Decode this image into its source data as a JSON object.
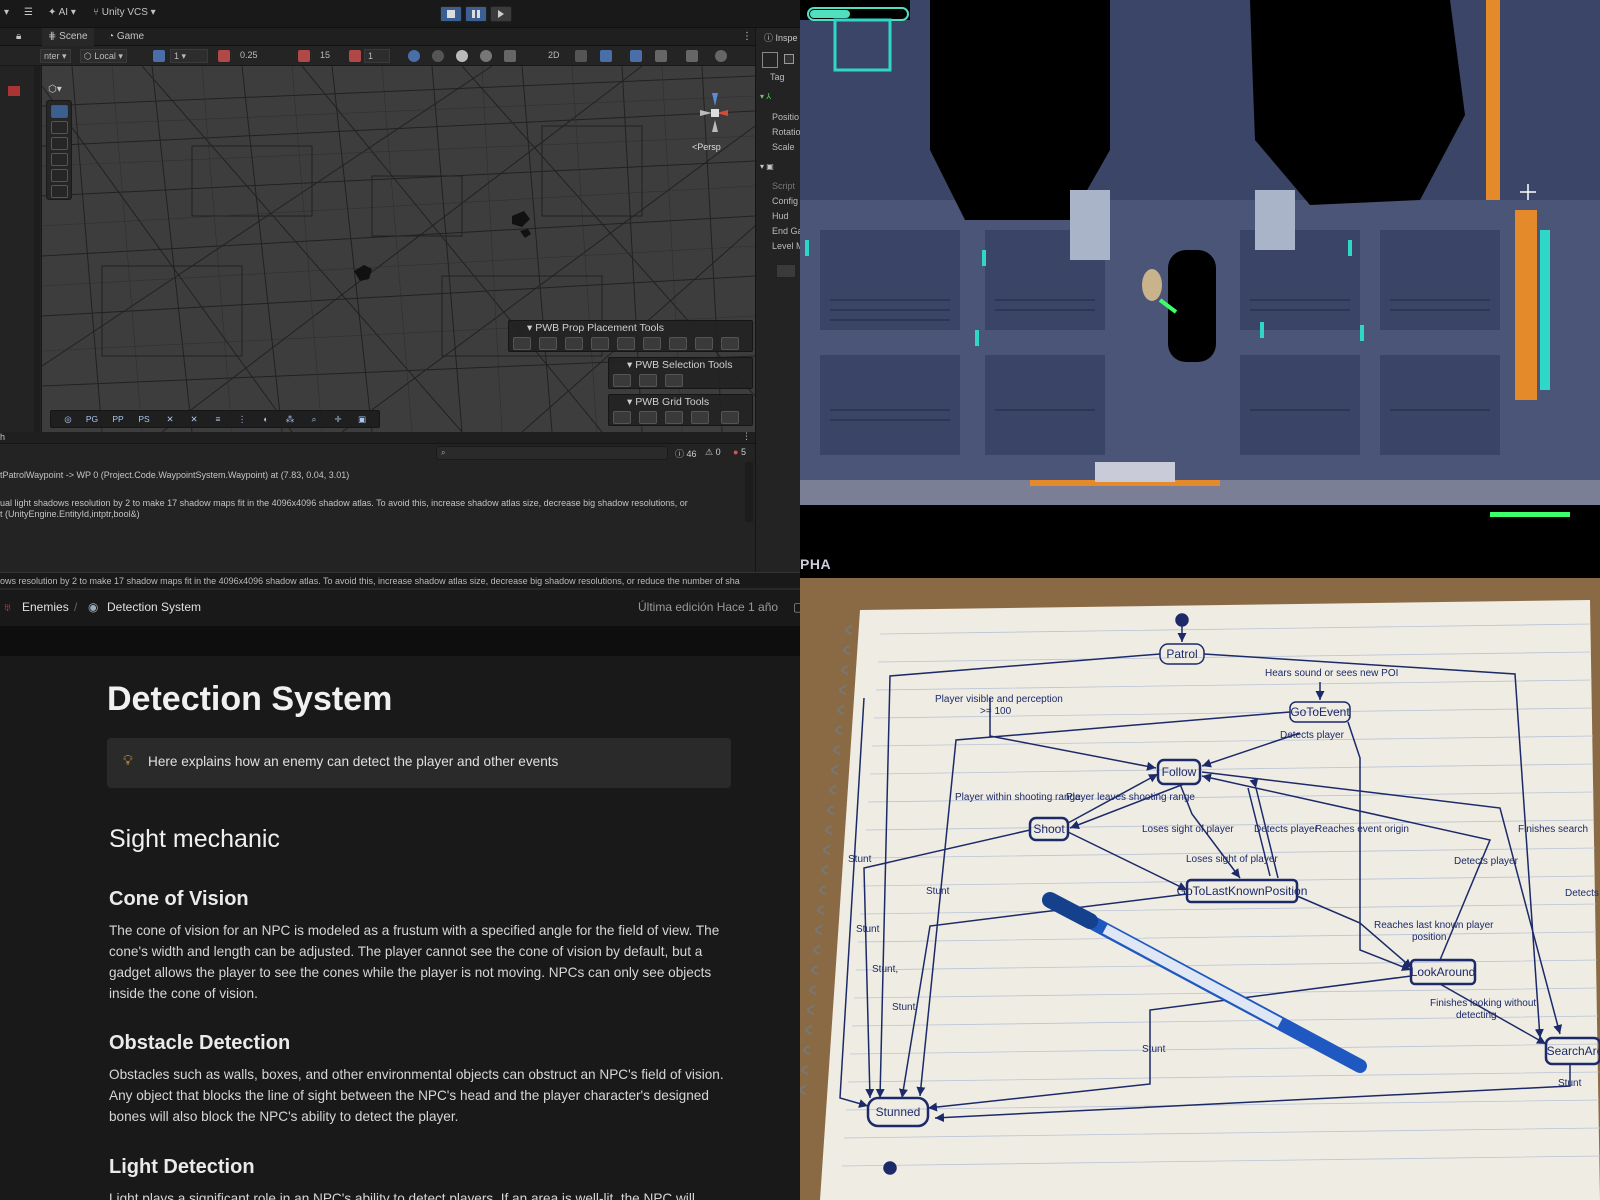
{
  "unity": {
    "toolbar": {
      "ai_label": "AI",
      "vcs_label": "Unity VCS"
    },
    "tabs": {
      "scene": "Scene",
      "game": "Game",
      "inspector": "Inspe"
    },
    "scene_toolbar": {
      "pivot": "nter",
      "space": "Local",
      "grid_value": "1",
      "snap_value": "0.25",
      "angle_value": "15",
      "scale_value": "1",
      "mode_2d": "2D"
    },
    "persp_label": "<Persp",
    "overlays": {
      "prop_placement": "PWB Prop Placement Tools",
      "selection": "PWB Selection Tools",
      "grid": "PWB Grid Tools"
    },
    "bottom_toolbar": [
      "PG",
      "PP",
      "PS"
    ],
    "console": {
      "tab_fragment": "h",
      "counts": {
        "logs": "46",
        "warnings": "0",
        "errors": "5"
      },
      "line1": "tPatrolWaypoint -> WP 0 (Project.Code.WaypointSystem.Waypoint) at (7.83, 0.04, 3.01)",
      "line2": "ual light shadows resolution by 2 to make 17 shadow maps fit in the 4096x4096 shadow atlas. To avoid this, increase shadow atlas size, decrease big shadow resolutions, or",
      "line3": "t (UnityEngine.EntityId,intptr,bool&)"
    },
    "status_message": "ows resolution by 2 to make 17 shadow maps fit in the 4096x4096 shadow atlas. To avoid this, increase shadow atlas size, decrease big shadow resolutions, or reduce the number of sha",
    "inspector": {
      "tag": "Tag",
      "transform": [
        "Positio",
        "Rotatio",
        "Scale"
      ],
      "component": [
        "Script",
        "Config",
        "Hud",
        "End Ga",
        "Level M"
      ]
    }
  },
  "game": {
    "overlay_text": "PHA"
  },
  "notion": {
    "breadcrumb": {
      "parent": "Enemies",
      "current": "Detection System",
      "last_edited": "Última edición Hace 1 año"
    },
    "title": "Detection System",
    "callout": "Here explains how an enemy can detect the player and other events",
    "h2_sight": "Sight mechanic",
    "cone_heading": "Cone of Vision",
    "cone_text": "The cone of vision for an NPC is modeled as a frustum with a specified angle for the field of view. The cone's width and length can be adjusted. The player cannot see the cone of vision by default, but a gadget allows the player to see the cones while the player is not moving. NPCs can only see objects inside the cone of vision.",
    "obstacle_heading": "Obstacle Detection",
    "obstacle_text": "Obstacles such as walls, boxes, and other environmental objects can obstruct an NPC's field of vision. Any object that blocks the line of sight between the NPC's head and the player character's designed bones will also block the NPC's ability to detect the player.",
    "light_heading": "Light Detection",
    "light_text": "Light plays a significant role in an NPC's ability to detect players. If an area is well-lit, the NPC will"
  },
  "diagram": {
    "states": {
      "patrol": "Patrol",
      "goto_event": "GoToEvent",
      "follow": "Follow",
      "shoot": "Shoot",
      "goto_last": "GoToLastKnownPosition",
      "look_around": "LookAround",
      "search_area": "SearchAre",
      "stunned": "Stunned"
    },
    "labels": {
      "hears_sound": "Hears sound or sees new POI",
      "player_visible": "Player visible and perception",
      "perception_value": ">= 100",
      "detects_player": "Detects player",
      "within_range": "Player within shooting range",
      "leaves_range": "Player leaves shooting range",
      "loses_sight": "Loses sight of player",
      "reaches_origin": "Reaches event origin",
      "finishes_search": "Finishes search",
      "reaches_last": "Reaches last known player",
      "position": "position",
      "finishes_looking": "Finishes looking without",
      "detecting": "detecting",
      "stunt": "Stunt",
      "stunt_comma": "Stunt,",
      "detects_fragment": "Detects"
    }
  }
}
